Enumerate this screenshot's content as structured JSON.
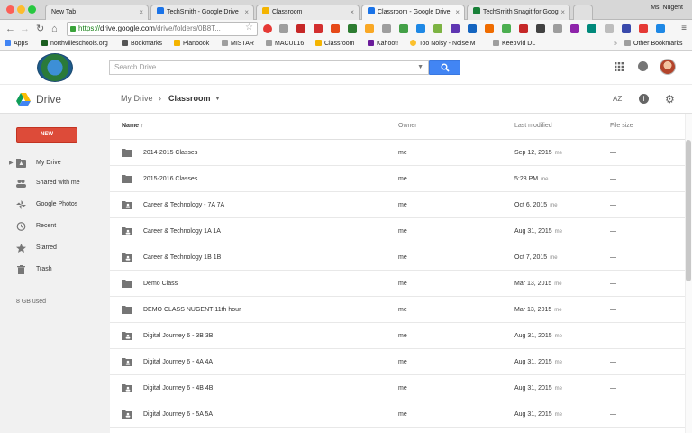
{
  "browser": {
    "tabs": [
      {
        "title": "New Tab",
        "color": "#dddddd"
      },
      {
        "title": "TechSmith - Google Drive",
        "color": "#1a73e8"
      },
      {
        "title": "Classroom",
        "color": "#f4b400"
      },
      {
        "title": "Classroom - Google Drive",
        "color": "#1a73e8"
      },
      {
        "title": "TechSmith Snagit for Goog",
        "color": "#188038"
      }
    ],
    "user": "Ms. Nugent",
    "url_scheme": "https://",
    "url_host": "drive.google.com",
    "url_path": "/drive/folders/0B8T...",
    "bookmarks": [
      {
        "label": "Apps",
        "color": "#4285f4"
      },
      {
        "label": "northvilleschools.org",
        "color": "#1b5e20"
      },
      {
        "label": "Bookmarks",
        "color": "#555555"
      },
      {
        "label": "Planbook",
        "color": "#f4b400"
      },
      {
        "label": "MISTAR",
        "color": "#9e9e9e"
      },
      {
        "label": "MACUL16",
        "color": "#9e9e9e"
      },
      {
        "label": "Classroom",
        "color": "#f4b400"
      },
      {
        "label": "Kahoot!",
        "color": "#6a1b9a"
      },
      {
        "label": "Too Noisy - Noise M",
        "color": "#fbc02d"
      },
      {
        "label": "KeepVid DL",
        "color": "#9e9e9e"
      },
      {
        "label": "Other Bookmarks",
        "color": "#9e9e9e"
      }
    ]
  },
  "google": {
    "search_placeholder": "Search Drive"
  },
  "drive": {
    "title": "Drive",
    "breadcrumb_root": "My Drive",
    "breadcrumb_current": "Classroom",
    "new_button": "NEW",
    "nav": [
      {
        "label": "My Drive",
        "icon": "my-drive-icon"
      },
      {
        "label": "Shared with me",
        "icon": "people-icon"
      },
      {
        "label": "Google Photos",
        "icon": "photos-icon"
      },
      {
        "label": "Recent",
        "icon": "clock-icon"
      },
      {
        "label": "Starred",
        "icon": "star-icon"
      },
      {
        "label": "Trash",
        "icon": "trash-icon"
      }
    ],
    "storage": "8 GB used",
    "columns": {
      "name": "Name",
      "owner": "Owner",
      "modified": "Last modified",
      "size": "File size"
    },
    "files": [
      {
        "name": "2014-2015 Classes",
        "owner": "me",
        "modified": "Sep 12, 2015",
        "by": "me",
        "size": "—",
        "shared": false
      },
      {
        "name": "2015-2016 Classes",
        "owner": "me",
        "modified": "5:28 PM",
        "by": "me",
        "size": "—",
        "shared": false
      },
      {
        "name": "Career & Technology - 7A 7A",
        "owner": "me",
        "modified": "Oct 6, 2015",
        "by": "me",
        "size": "—",
        "shared": true
      },
      {
        "name": "Career & Technology 1A 1A",
        "owner": "me",
        "modified": "Aug 31, 2015",
        "by": "me",
        "size": "—",
        "shared": true
      },
      {
        "name": "Career & Technology 1B 1B",
        "owner": "me",
        "modified": "Oct 7, 2015",
        "by": "me",
        "size": "—",
        "shared": true
      },
      {
        "name": "Demo Class",
        "owner": "me",
        "modified": "Mar 13, 2015",
        "by": "me",
        "size": "—",
        "shared": false
      },
      {
        "name": "DEMO CLASS NUGENT-11th hour",
        "owner": "me",
        "modified": "Mar 13, 2015",
        "by": "me",
        "size": "—",
        "shared": false
      },
      {
        "name": "Digital Journey 6 - 3B 3B",
        "owner": "me",
        "modified": "Aug 31, 2015",
        "by": "me",
        "size": "—",
        "shared": true
      },
      {
        "name": "Digital Journey 6 - 4A 4A",
        "owner": "me",
        "modified": "Aug 31, 2015",
        "by": "me",
        "size": "—",
        "shared": true
      },
      {
        "name": "Digital Journey 6 - 4B 4B",
        "owner": "me",
        "modified": "Aug 31, 2015",
        "by": "me",
        "size": "—",
        "shared": true
      },
      {
        "name": "Digital Journey 6 - 5A 5A",
        "owner": "me",
        "modified": "Aug 31, 2015",
        "by": "me",
        "size": "—",
        "shared": true
      }
    ]
  }
}
